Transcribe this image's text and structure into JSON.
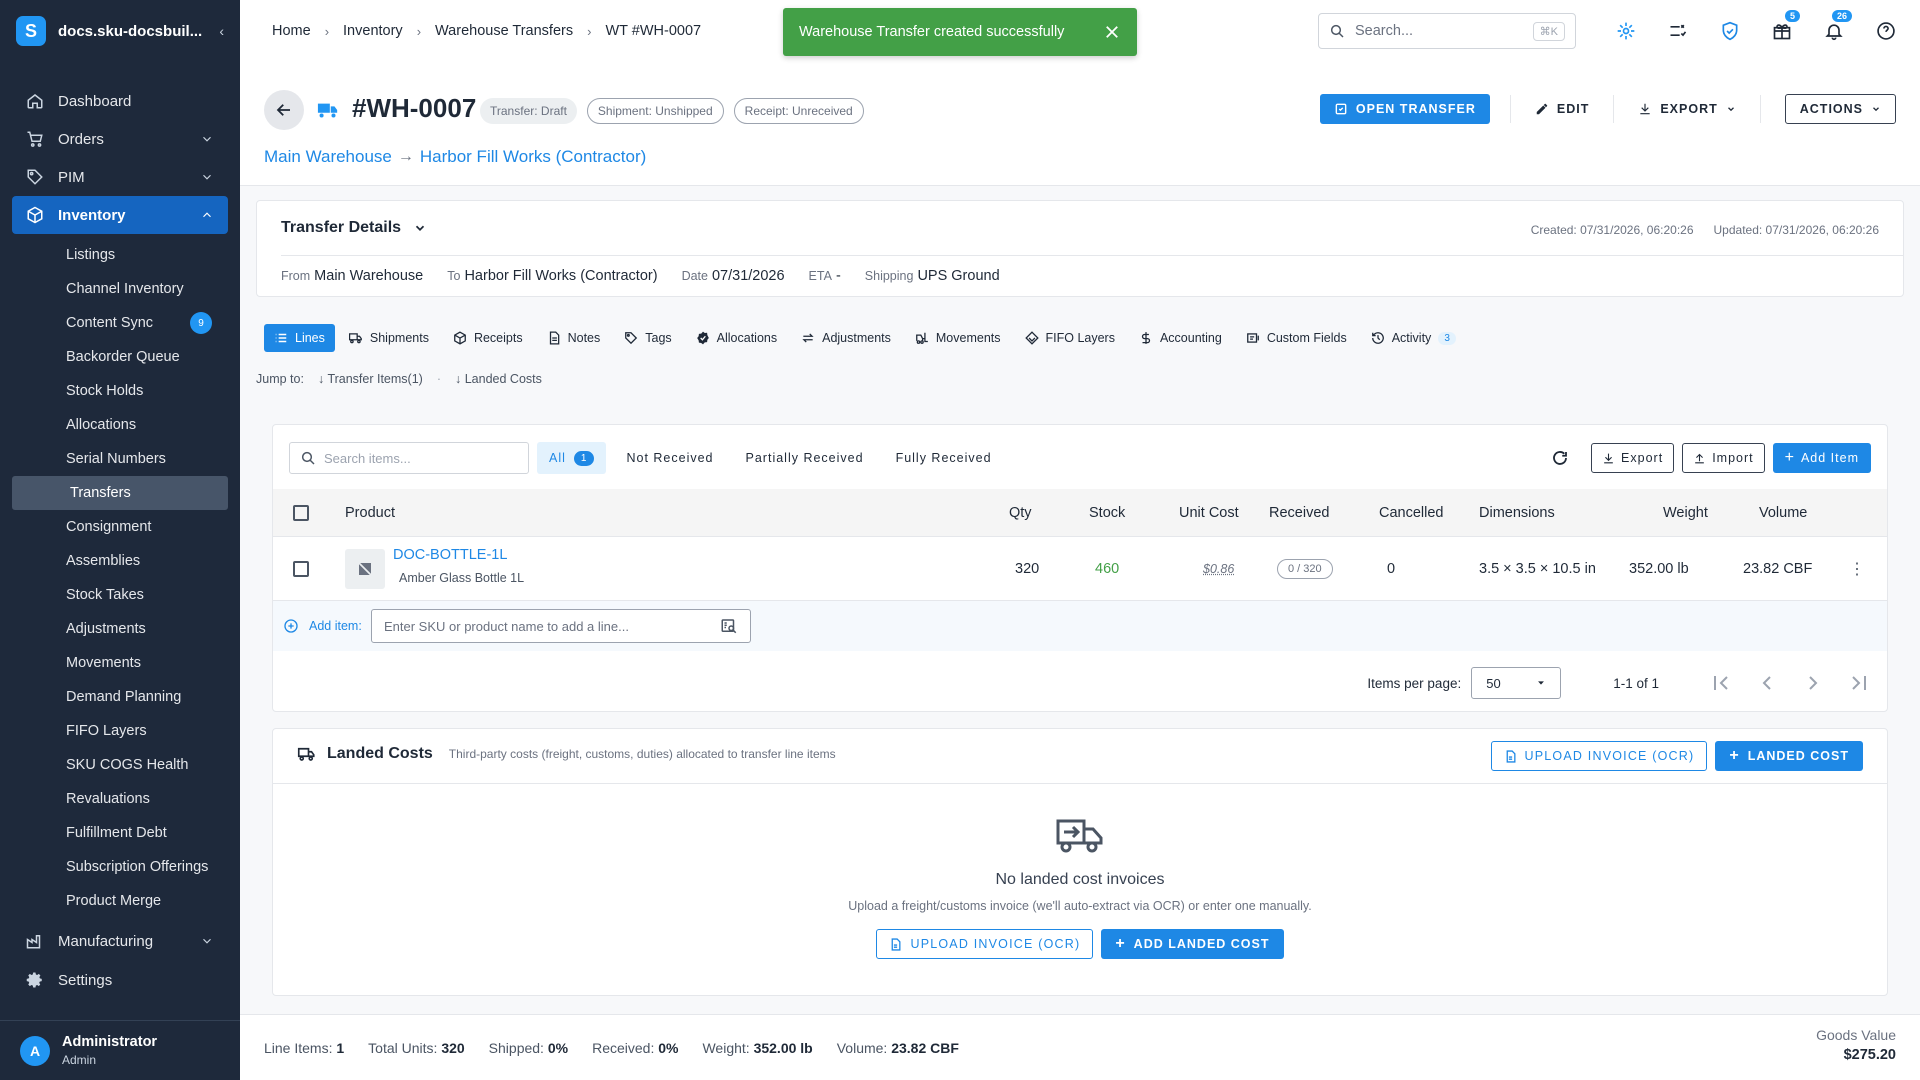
{
  "brand": {
    "name": "docs.sku-docsbuil...",
    "logo_letter": "S"
  },
  "sidebar": {
    "items": [
      {
        "label": "Dashboard",
        "icon": "home-icon"
      },
      {
        "label": "Orders",
        "icon": "cart-icon"
      },
      {
        "label": "PIM",
        "icon": "tag-icon"
      },
      {
        "label": "Inventory",
        "icon": "box-icon"
      }
    ],
    "inventory_sub": [
      {
        "label": "Listings"
      },
      {
        "label": "Channel Inventory"
      },
      {
        "label": "Content Sync",
        "badge": "9"
      },
      {
        "label": "Backorder Queue"
      },
      {
        "label": "Stock Holds"
      },
      {
        "label": "Allocations"
      },
      {
        "label": "Serial Numbers"
      },
      {
        "label": "Transfers"
      },
      {
        "label": "Consignment"
      },
      {
        "label": "Assemblies"
      },
      {
        "label": "Stock Takes"
      },
      {
        "label": "Adjustments"
      },
      {
        "label": "Movements"
      },
      {
        "label": "Demand Planning"
      },
      {
        "label": "FIFO Layers"
      },
      {
        "label": "SKU COGS Health"
      },
      {
        "label": "Revaluations"
      },
      {
        "label": "Fulfillment Debt"
      },
      {
        "label": "Subscription Offerings"
      },
      {
        "label": "Product Merge"
      }
    ],
    "manufacturing": "Manufacturing",
    "settings": "Settings",
    "user": {
      "name": "Administrator",
      "role": "Admin",
      "initial": "A"
    }
  },
  "breadcrumbs": [
    "Home",
    "Inventory",
    "Warehouse Transfers",
    "WT #WH-0007"
  ],
  "toast": "Warehouse Transfer created successfully",
  "topbar": {
    "search_placeholder": "Search...",
    "shortcut": "⌘K",
    "gift_badge": "5",
    "bell_badge": "26"
  },
  "header": {
    "title": "#WH-0007",
    "chips": [
      "Transfer: Draft",
      "Shipment: Unshipped",
      "Receipt: Unreceived"
    ],
    "from": "Main Warehouse",
    "to": "Harbor Fill Works (Contractor)",
    "open_transfer": "OPEN TRANSFER",
    "edit": "EDIT",
    "export": "EXPORT",
    "actions": "ACTIONS"
  },
  "details": {
    "title": "Transfer Details",
    "created": "Created: 07/31/2026, 06:20:26",
    "updated": "Updated: 07/31/2026, 06:20:26",
    "from_k": "From",
    "from_v": "Main Warehouse",
    "to_k": "To",
    "to_v": "Harbor Fill Works (Contractor)",
    "date_k": "Date",
    "date_v": "07/31/2026",
    "eta_k": "ETA",
    "eta_v": "-",
    "ship_k": "Shipping",
    "ship_v": "UPS Ground"
  },
  "tabs": [
    {
      "label": "Lines",
      "icon": "list-icon"
    },
    {
      "label": "Shipments",
      "icon": "truck-icon"
    },
    {
      "label": "Receipts",
      "icon": "package-icon"
    },
    {
      "label": "Notes",
      "icon": "note-icon"
    },
    {
      "label": "Tags",
      "icon": "tag-icon"
    },
    {
      "label": "Allocations",
      "icon": "check-badge-icon"
    },
    {
      "label": "Adjustments",
      "icon": "swap-icon"
    },
    {
      "label": "Movements",
      "icon": "forklift-icon"
    },
    {
      "label": "FIFO Layers",
      "icon": "layers-icon"
    },
    {
      "label": "Accounting",
      "icon": "dollar-icon"
    },
    {
      "label": "Custom Fields",
      "icon": "fields-icon"
    },
    {
      "label": "Activity",
      "icon": "history-icon",
      "count": "3"
    }
  ],
  "jump": {
    "label": "Jump to:",
    "a": "Transfer Items(1)",
    "b": "Landed Costs"
  },
  "lines": {
    "search_placeholder": "Search items...",
    "filters": [
      {
        "label": "All",
        "count": "1"
      },
      {
        "label": "Not Received"
      },
      {
        "label": "Partially Received"
      },
      {
        "label": "Fully Received"
      }
    ],
    "export": "Export",
    "import": "Import",
    "add_item": "Add Item",
    "columns": [
      "Product",
      "Qty",
      "Stock",
      "Unit Cost",
      "Received",
      "Cancelled",
      "Dimensions",
      "Weight",
      "Volume"
    ],
    "row": {
      "sku": "DOC-BOTTLE-1L",
      "name": "Amber Glass Bottle 1L",
      "qty": "320",
      "stock": "460",
      "unit_cost": "$0.86",
      "received": "0 / 320",
      "cancelled": "0",
      "dimensions": "3.5 × 3.5 × 10.5 in",
      "weight": "352.00 lb",
      "volume": "23.82 CBF"
    },
    "add_label": "Add item:",
    "add_placeholder": "Enter SKU or product name to add a line...",
    "per_page_label": "Items per page:",
    "per_page": "50",
    "range": "1-1 of 1"
  },
  "landed": {
    "title": "Landed Costs",
    "subtitle": "Third-party costs (freight, customs, duties) allocated to transfer line items",
    "upload": "UPLOAD INVOICE (OCR)",
    "add": "LANDED COST",
    "empty_title": "No landed cost invoices",
    "empty_sub": "Upload a freight/customs invoice (we'll auto-extract via OCR) or enter one manually.",
    "empty_upload": "UPLOAD INVOICE (OCR)",
    "empty_add": "ADD LANDED COST"
  },
  "footer": {
    "line_items_k": "Line Items:",
    "line_items_v": "1",
    "units_k": "Total Units:",
    "units_v": "320",
    "shipped_k": "Shipped:",
    "shipped_v": "0%",
    "received_k": "Received:",
    "received_v": "0%",
    "weight_k": "Weight:",
    "weight_v": "352.00 lb",
    "volume_k": "Volume:",
    "volume_v": "23.82 CBF",
    "goods_k": "Goods Value",
    "goods_v": "$275.20"
  },
  "colors": {
    "primary": "#1e88e5",
    "sidebar": "#1e293b",
    "success": "#43a047"
  }
}
